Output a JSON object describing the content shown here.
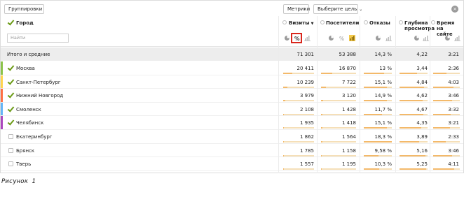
{
  "toolbar": {
    "groupings_label": "Группировки",
    "metrics_label": "Метрики",
    "goal_label": "Выберите цель",
    "close_glyph": "×"
  },
  "header": {
    "city_label": "Город",
    "search_placeholder": "Найти",
    "columns": [
      {
        "label": "Визиты",
        "sort": "▼"
      },
      {
        "label": "Посетители"
      },
      {
        "label": "Отказы"
      },
      {
        "label": "Глубина просмотра"
      },
      {
        "label": "Время на сайте"
      }
    ],
    "percent_glyph": "%"
  },
  "totals": {
    "label": "Итого и средние",
    "values": [
      "71 301",
      "53 388",
      "14,3 %",
      "4,22",
      "3:21"
    ]
  },
  "rows": [
    {
      "city": "Москва",
      "checked": true,
      "color": "#8bc34a",
      "values": [
        "20 411",
        "16 870",
        "13 %",
        "3,44",
        "2:36"
      ],
      "bars": [
        0.29,
        0.32,
        0.72,
        0.62,
        0.49
      ]
    },
    {
      "city": "Санкт-Петербург",
      "checked": true,
      "color": "#ffd54f",
      "values": [
        "10 239",
        "7 722",
        "15,1 %",
        "4,84",
        "4:03"
      ],
      "bars": [
        0.14,
        0.14,
        0.83,
        0.87,
        0.76
      ]
    },
    {
      "city": "Нижний Новгород",
      "checked": true,
      "color": "#ff7043",
      "values": [
        "3 979",
        "3 120",
        "14,9 %",
        "4,62",
        "3:46"
      ],
      "bars": [
        0.06,
        0.06,
        0.82,
        0.83,
        0.71
      ]
    },
    {
      "city": "Смоленск",
      "checked": true,
      "color": "#64b5f6",
      "values": [
        "2 108",
        "1 428",
        "11,7 %",
        "4,67",
        "3:32"
      ],
      "bars": [
        0.03,
        0.03,
        0.64,
        0.84,
        0.66
      ]
    },
    {
      "city": "Челябинск",
      "checked": true,
      "color": "#ab47bc",
      "values": [
        "1 935",
        "1 418",
        "15,1 %",
        "4,35",
        "3:21"
      ],
      "bars": [
        0.03,
        0.03,
        0.83,
        0.78,
        0.63
      ]
    },
    {
      "city": "Екатеринбург",
      "checked": false,
      "color": "",
      "values": [
        "1 862",
        "1 564",
        "18,3 %",
        "3,89",
        "2:33"
      ],
      "bars": [
        0.03,
        0.03,
        1.0,
        0.7,
        0.48
      ]
    },
    {
      "city": "Брянск",
      "checked": false,
      "color": "",
      "values": [
        "1 785",
        "1 158",
        "9,58 %",
        "5,16",
        "3:46"
      ],
      "bars": [
        0.03,
        0.02,
        0.52,
        0.93,
        0.71
      ]
    },
    {
      "city": "Тверь",
      "checked": false,
      "color": "",
      "values": [
        "1 557",
        "1 195",
        "10,3 %",
        "5,25",
        "4:11"
      ],
      "bars": [
        0.02,
        0.02,
        0.56,
        0.95,
        0.79
      ]
    }
  ],
  "caption": "Рисунок 1"
}
